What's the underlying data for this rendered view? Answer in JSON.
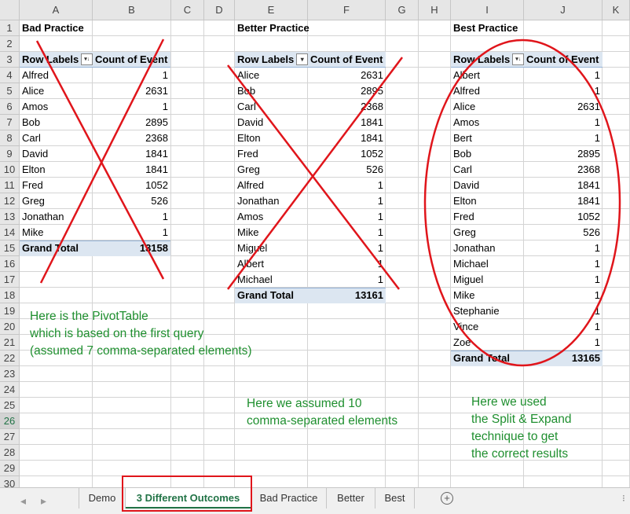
{
  "columns": [
    "A",
    "B",
    "C",
    "D",
    "E",
    "F",
    "G",
    "H",
    "I",
    "J",
    "K"
  ],
  "rows": [
    "1",
    "2",
    "3",
    "4",
    "5",
    "6",
    "7",
    "8",
    "9",
    "10",
    "11",
    "12",
    "13",
    "14",
    "15",
    "16",
    "17",
    "18",
    "19",
    "20",
    "21",
    "22",
    "23",
    "24",
    "25",
    "26",
    "27",
    "28",
    "29",
    "30"
  ],
  "selected_row": "26",
  "tables": {
    "bad": {
      "title": "Bad Practice",
      "hdr_labels": "Row Labels",
      "hdr_count": "Count of Event",
      "items": [
        [
          "Alfred",
          "1"
        ],
        [
          "Alice",
          "2631"
        ],
        [
          "Amos",
          "1"
        ],
        [
          "Bob",
          "2895"
        ],
        [
          "Carl",
          "2368"
        ],
        [
          "David",
          "1841"
        ],
        [
          "Elton",
          "1841"
        ],
        [
          "Fred",
          "1052"
        ],
        [
          "Greg",
          "526"
        ],
        [
          "Jonathan",
          "1"
        ],
        [
          "Mike",
          "1"
        ]
      ],
      "total_label": "Grand Total",
      "total": "13158"
    },
    "better": {
      "title": "Better Practice",
      "hdr_labels": "Row Labels",
      "hdr_count": "Count of Event",
      "items": [
        [
          "Alice",
          "2631"
        ],
        [
          "Bob",
          "2895"
        ],
        [
          "Carl",
          "2368"
        ],
        [
          "David",
          "1841"
        ],
        [
          "Elton",
          "1841"
        ],
        [
          "Fred",
          "1052"
        ],
        [
          "Greg",
          "526"
        ],
        [
          "Alfred",
          "1"
        ],
        [
          "Jonathan",
          "1"
        ],
        [
          "Amos",
          "1"
        ],
        [
          "Mike",
          "1"
        ],
        [
          "Miguel",
          "1"
        ],
        [
          "Albert",
          "1"
        ],
        [
          "Michael",
          "1"
        ]
      ],
      "total_label": "Grand Total",
      "total": "13161"
    },
    "best": {
      "title": "Best Practice",
      "hdr_labels": "Row Labels",
      "hdr_count": "Count of Event",
      "items": [
        [
          "Albert",
          "1"
        ],
        [
          "Alfred",
          "1"
        ],
        [
          "Alice",
          "2631"
        ],
        [
          "Amos",
          "1"
        ],
        [
          "Bert",
          "1"
        ],
        [
          "Bob",
          "2895"
        ],
        [
          "Carl",
          "2368"
        ],
        [
          "David",
          "1841"
        ],
        [
          "Elton",
          "1841"
        ],
        [
          "Fred",
          "1052"
        ],
        [
          "Greg",
          "526"
        ],
        [
          "Jonathan",
          "1"
        ],
        [
          "Michael",
          "1"
        ],
        [
          "Miguel",
          "1"
        ],
        [
          "Mike",
          "1"
        ],
        [
          "Stephanie",
          "1"
        ],
        [
          "Vince",
          "1"
        ],
        [
          "Zoe",
          "1"
        ]
      ],
      "total_label": "Grand Total",
      "total": "13165"
    }
  },
  "notes": {
    "bad": [
      "Here is the PivotTable",
      "which is based on the first query",
      "(assumed 7 comma-separated elements)"
    ],
    "better": [
      "Here we assumed 10",
      "comma-separated elements"
    ],
    "best": [
      "Here we used",
      "the Split & Expand",
      "technique to get",
      "the correct results"
    ]
  },
  "sheet_tabs": [
    "Demo",
    "3 Different Outcomes",
    "Bad Practice",
    "Better",
    "Best"
  ],
  "active_tab": "3 Different Outcomes",
  "accent_colors": {
    "excel_green": "#217346",
    "annotation_red": "#e0151b",
    "note_green": "#1f8f2f",
    "pivot_header": "#dce6f1"
  }
}
